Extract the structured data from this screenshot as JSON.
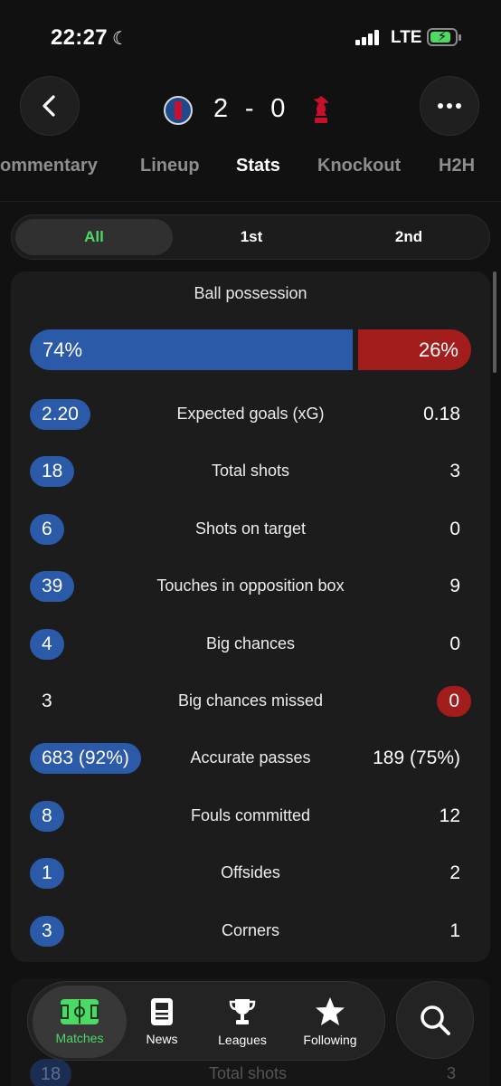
{
  "status_bar": {
    "time": "22:27",
    "network": "LTE",
    "icons": [
      "moon-icon",
      "signal-icon",
      "battery-charging-icon"
    ]
  },
  "header": {
    "home_team_icon": "psg-crest-icon",
    "away_team_icon": "liverpool-crest-icon",
    "home_score": "2",
    "separator": "-",
    "away_score": "0",
    "back_icon": "chevron-left-icon",
    "more_icon": "more-dots-icon"
  },
  "tabs": [
    {
      "label": "ommentary",
      "active": false
    },
    {
      "label": "Lineup",
      "active": false
    },
    {
      "label": "Stats",
      "active": true
    },
    {
      "label": "Knockout",
      "active": false
    },
    {
      "label": "H2H",
      "active": false
    }
  ],
  "period_switch": [
    {
      "label": "All",
      "active": true
    },
    {
      "label": "1st",
      "active": false
    },
    {
      "label": "2nd",
      "active": false
    }
  ],
  "possession": {
    "title": "Ball possession",
    "home_label": "74%",
    "away_label": "26%",
    "home_fraction": 0.74,
    "away_fraction": 0.26
  },
  "stats": [
    {
      "name": "Expected goals (xG)",
      "home": "2.20",
      "away": "0.18",
      "leader": "home"
    },
    {
      "name": "Total shots",
      "home": "18",
      "away": "3",
      "leader": "home"
    },
    {
      "name": "Shots on target",
      "home": "6",
      "away": "0",
      "leader": "home"
    },
    {
      "name": "Touches in opposition box",
      "home": "39",
      "away": "9",
      "leader": "home"
    },
    {
      "name": "Big chances",
      "home": "4",
      "away": "0",
      "leader": "home"
    },
    {
      "name": "Big chances missed",
      "home": "3",
      "away": "0",
      "leader": "away"
    },
    {
      "name": "Accurate passes",
      "home": "683 (92%)",
      "away": "189 (75%)",
      "leader": "home"
    },
    {
      "name": "Fouls committed",
      "home": "8",
      "away": "12",
      "leader": "home"
    },
    {
      "name": "Offsides",
      "home": "1",
      "away": "2",
      "leader": "home"
    },
    {
      "name": "Corners",
      "home": "3",
      "away": "1",
      "leader": "home"
    }
  ],
  "ghost": {
    "home": "18",
    "name": "Total shots",
    "away": "3"
  },
  "bottom_nav": [
    {
      "label": "Matches",
      "icon": "pitch-icon",
      "active": true
    },
    {
      "label": "News",
      "icon": "news-icon",
      "active": false
    },
    {
      "label": "Leagues",
      "icon": "trophy-icon",
      "active": false
    },
    {
      "label": "Following",
      "icon": "star-icon",
      "active": false
    }
  ],
  "search_icon": "search-icon",
  "colors": {
    "home": "#2b5aa8",
    "away": "#a31d1d",
    "accent": "#4cd964",
    "background": "#111111",
    "card": "#1c1c1c"
  }
}
